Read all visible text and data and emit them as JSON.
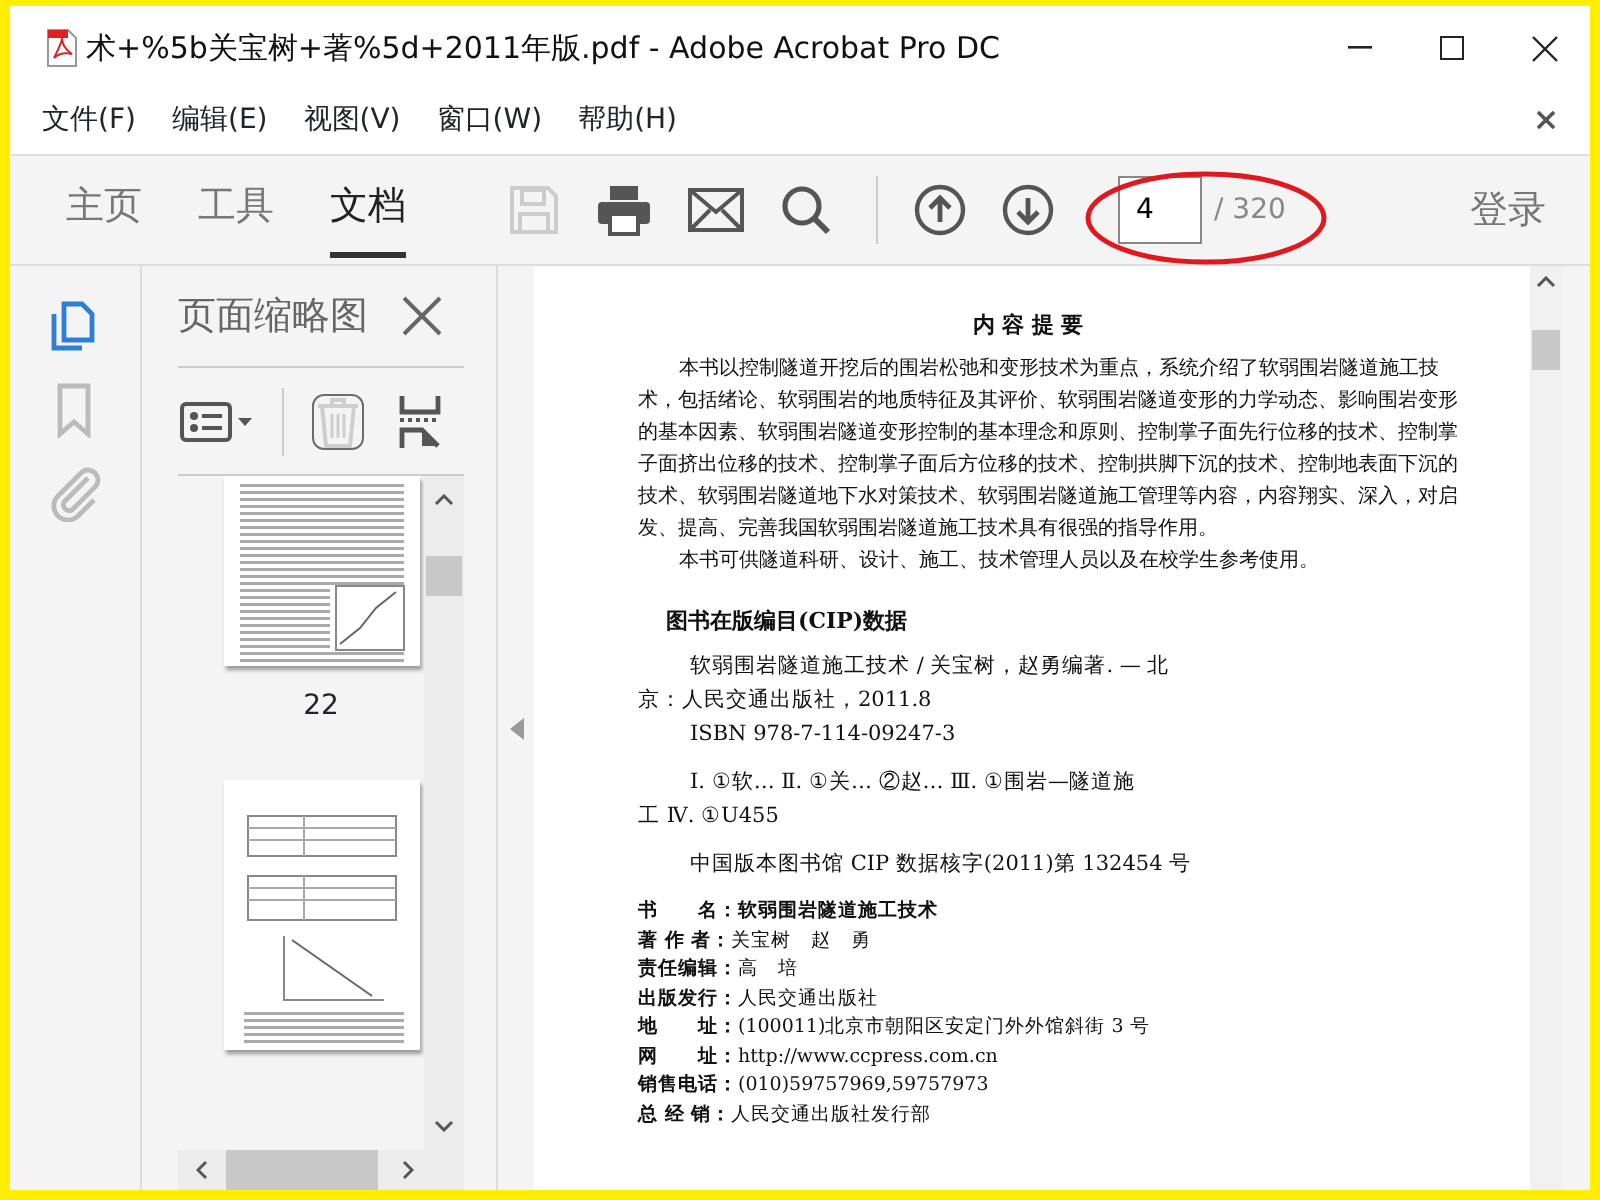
{
  "window": {
    "title": "术+%5b关宝树+著%5d+2011年版.pdf - Adobe Acrobat Pro DC"
  },
  "menu": [
    "文件(F)",
    "编辑(E)",
    "视图(V)",
    "窗口(W)",
    "帮助(H)"
  ],
  "toolbar": {
    "tabs": [
      {
        "label": "主页",
        "selected": false
      },
      {
        "label": "工具",
        "selected": false
      },
      {
        "label": "文档",
        "selected": true
      }
    ],
    "tools": [
      {
        "kind": "save",
        "disabled": true
      },
      {
        "kind": "print",
        "disabled": false
      },
      {
        "kind": "mail",
        "disabled": false
      },
      {
        "kind": "search",
        "disabled": false
      }
    ],
    "page_input": "4",
    "page_total": "/ 320",
    "sign_in": "登录"
  },
  "rail": [
    {
      "kind": "pages",
      "selected": true
    },
    {
      "kind": "bookmark",
      "selected": false
    },
    {
      "kind": "attachment",
      "selected": false
    }
  ],
  "thumbnails_panel": {
    "title": "页面缩略图",
    "thumbnails": [
      {
        "label": "22",
        "kind": "text"
      },
      {
        "kind": "tables"
      }
    ]
  },
  "document": {
    "heading": "内 容 提 要",
    "paragraphs": [
      "本书以控制隧道开挖后的围岩松弛和变形技术为重点，系统介绍了软弱围岩隧道施工技术，包括绪论、软弱围岩的地质特征及其评价、软弱围岩隧道变形的力学动态、影响围岩变形的基本因素、软弱围岩隧道变形控制的基本理念和原则、控制掌子面先行位移的技术、控制掌子面挤出位移的技术、控制掌子面后方位移的技术、控制拱脚下沉的技术、控制地表面下沉的技术、软弱围岩隧道地下水对策技术、软弱围岩隧道施工管理等内容，内容翔实、深入，对启发、提高、完善我国软弱围岩隧道施工技术具有很强的指导作用。",
      "本书可供隧道科研、设计、施工、技术管理人员以及在校学生参考使用。"
    ],
    "cip_heading": "图书在版编目(CIP)数据",
    "cip_lines": [
      {
        "text": "软弱围岩隧道施工技术 / 关宝树，赵勇编著. — 北",
        "indent": true,
        "gap": false
      },
      {
        "text": "京：人民交通出版社，2011.8",
        "indent": false,
        "gap": false
      },
      {
        "text": "ISBN 978-7-114-09247-3",
        "indent": true,
        "gap": false
      },
      {
        "text": "Ⅰ. ①软… Ⅱ. ①关… ②赵… Ⅲ. ①围岩—隧道施",
        "indent": true,
        "gap": true
      },
      {
        "text": "工 Ⅳ. ①U455",
        "indent": false,
        "gap": false
      },
      {
        "text": "中国版本图书馆 CIP 数据核字(2011)第 132454 号",
        "indent": true,
        "gap": true
      }
    ],
    "info": [
      {
        "label": "书　　名：",
        "value": "软弱围岩隧道施工技术",
        "emphasis": true
      },
      {
        "label": "著 作 者：",
        "value": "关宝树　赵　勇",
        "emphasis": false
      },
      {
        "label": "责任编辑：",
        "value": "高　培",
        "emphasis": false
      },
      {
        "label": "出版发行：",
        "value": "人民交通出版社",
        "emphasis": false
      },
      {
        "label": "地　　址：",
        "value": "(100011)北京市朝阳区安定门外外馆斜街 3 号",
        "emphasis": false
      },
      {
        "label": "网　　址：",
        "value": "http://www.ccpress.com.cn",
        "emphasis": false
      },
      {
        "label": "销售电话：",
        "value": "(010)59757969,59757973",
        "emphasis": false
      },
      {
        "label": "总 经 销：",
        "value": "人民交通出版社发行部",
        "emphasis": false
      }
    ]
  }
}
